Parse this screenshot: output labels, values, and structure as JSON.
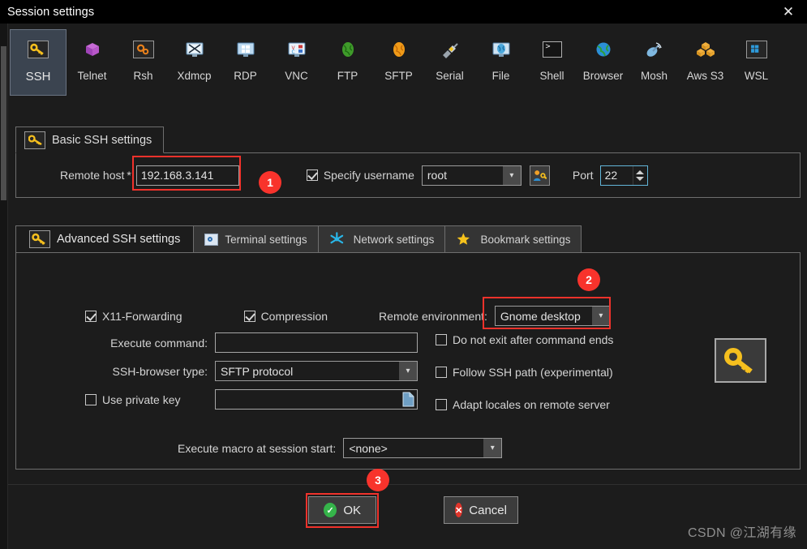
{
  "window": {
    "title": "Session settings",
    "close_icon": "close-x-icon"
  },
  "protocols": [
    {
      "id": "ssh",
      "label": "SSH",
      "icon": "key-icon",
      "selected": true
    },
    {
      "id": "telnet",
      "label": "Telnet",
      "icon": "purple-cube-icon",
      "selected": false
    },
    {
      "id": "rsh",
      "label": "Rsh",
      "icon": "orange-gears-icon",
      "selected": false
    },
    {
      "id": "xdmcp",
      "label": "Xdmcp",
      "icon": "x-monitor-icon",
      "selected": false
    },
    {
      "id": "rdp",
      "label": "RDP",
      "icon": "windows-monitor-icon",
      "selected": false
    },
    {
      "id": "vnc",
      "label": "VNC",
      "icon": "vnc-monitor-icon",
      "selected": false
    },
    {
      "id": "ftp",
      "label": "FTP",
      "icon": "green-globe-icon",
      "selected": false
    },
    {
      "id": "sftp",
      "label": "SFTP",
      "icon": "orange-globe-icon",
      "selected": false
    },
    {
      "id": "serial",
      "label": "Serial",
      "icon": "serial-plug-icon",
      "selected": false
    },
    {
      "id": "file",
      "label": "File",
      "icon": "file-monitor-icon",
      "selected": false
    },
    {
      "id": "shell",
      "label": "Shell",
      "icon": "terminal-prompt-icon",
      "selected": false
    },
    {
      "id": "browser",
      "label": "Browser",
      "icon": "blue-globe-icon",
      "selected": false
    },
    {
      "id": "mosh",
      "label": "Mosh",
      "icon": "satellite-dish-icon",
      "selected": false
    },
    {
      "id": "awss3",
      "label": "Aws S3",
      "icon": "aws-cubes-icon",
      "selected": false
    },
    {
      "id": "wsl",
      "label": "WSL",
      "icon": "windows-logo-icon",
      "selected": false
    }
  ],
  "basic": {
    "legend": "Basic SSH settings",
    "legend_icon": "key-icon",
    "remote_host_label": "Remote host",
    "remote_host_required": "*",
    "remote_host_value": "192.168.3.141",
    "specify_username_label": "Specify username",
    "specify_username_checked": true,
    "username_value": "root",
    "user_button_icon": "user-key-icon",
    "port_label": "Port",
    "port_value": "22"
  },
  "tabs": [
    {
      "id": "advanced",
      "label": "Advanced SSH settings",
      "icon": "key-icon",
      "active": true
    },
    {
      "id": "terminal",
      "label": "Terminal settings",
      "icon": "terminal-icon",
      "active": false
    },
    {
      "id": "network",
      "label": "Network settings",
      "icon": "network-icon",
      "active": false
    },
    {
      "id": "bookmark",
      "label": "Bookmark settings",
      "icon": "star-icon",
      "active": false
    }
  ],
  "advanced": {
    "x11_label": "X11-Forwarding",
    "x11_checked": true,
    "compression_label": "Compression",
    "compression_checked": true,
    "remote_env_label": "Remote environment:",
    "remote_env_value": "Gnome desktop",
    "execute_command_label": "Execute command:",
    "execute_command_value": "",
    "ssh_browser_label": "SSH-browser type:",
    "ssh_browser_value": "SFTP protocol",
    "use_private_key_label": "Use private key",
    "use_private_key_checked": false,
    "private_key_value": "",
    "private_key_browse_icon": "file-page-icon",
    "do_not_exit_label": "Do not exit after command ends",
    "do_not_exit_checked": false,
    "follow_ssh_path_label": "Follow SSH path (experimental)",
    "follow_ssh_path_checked": false,
    "adapt_locales_label": "Adapt locales on remote server",
    "adapt_locales_checked": false,
    "macro_label": "Execute macro at session start:",
    "macro_value": "<none>",
    "side_icon": "key-icon"
  },
  "footer": {
    "ok_label": "OK",
    "cancel_label": "Cancel",
    "ok_icon": "green-check-icon",
    "cancel_icon": "red-x-icon"
  },
  "annotations": {
    "marker1": "1",
    "marker2": "2",
    "marker3": "3",
    "highlight_color": "#f0322b"
  },
  "watermark": "CSDN @江湖有缘"
}
